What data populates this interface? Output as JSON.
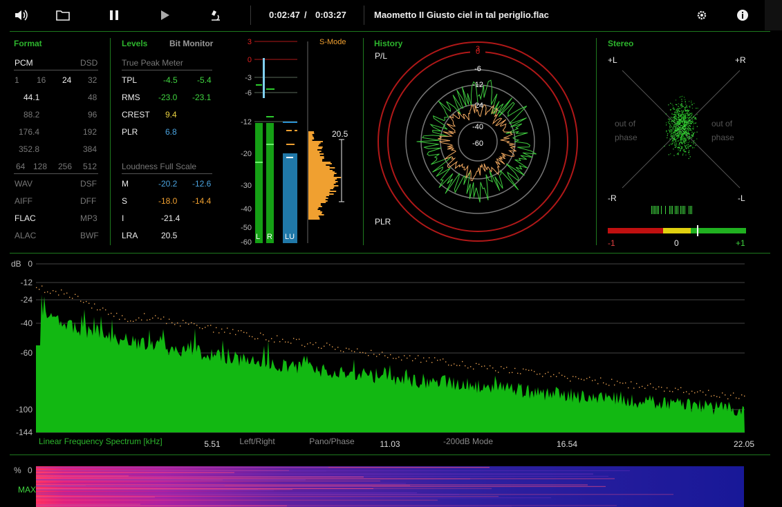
{
  "toolbar": {
    "time_current": "0:02:47",
    "time_separator": "/",
    "time_total": "0:03:27",
    "track_title": "Maometto II Giusto ciel in tal periglio.flac"
  },
  "format": {
    "title": "Format",
    "pcm": "PCM",
    "dsd": "DSD",
    "bits": [
      "1",
      "16",
      "24",
      "32"
    ],
    "rates": [
      [
        "44.1",
        "48"
      ],
      [
        "88.2",
        "96"
      ],
      [
        "176.4",
        "192"
      ],
      [
        "352.8",
        "384"
      ]
    ],
    "dsd_rates": [
      "64",
      "128",
      "256",
      "512"
    ],
    "containers": [
      [
        "WAV",
        "DSF"
      ],
      [
        "AIFF",
        "DFF"
      ],
      [
        "FLAC",
        "MP3"
      ],
      [
        "ALAC",
        "BWF"
      ]
    ]
  },
  "levels": {
    "title": "Levels",
    "bitmonitor": "Bit Monitor",
    "true_peak_label": "True Peak Meter",
    "tpl": {
      "label": "TPL",
      "l": "-4.5",
      "r": "-5.4"
    },
    "rms": {
      "label": "RMS",
      "l": "-23.0",
      "r": "-23.1"
    },
    "crest": {
      "label": "CREST",
      "v": "9.4"
    },
    "plr": {
      "label": "PLR",
      "v": "6.8"
    },
    "loudness_label": "Loudness Full Scale",
    "m": {
      "label": "M",
      "a": "-20.2",
      "b": "-12.6"
    },
    "s": {
      "label": "S",
      "a": "-18.0",
      "b": "-14.4"
    },
    "i": {
      "label": "I",
      "v": "-21.4"
    },
    "lra": {
      "label": "LRA",
      "v": "20.5"
    }
  },
  "meters": {
    "scale": [
      "3",
      "0",
      "-3",
      "-6",
      "-12",
      "-20",
      "-30",
      "-40",
      "-50",
      "-60"
    ],
    "smode": "S-Mode",
    "lra_value": "20.5",
    "l": "L",
    "r": "R",
    "lu": "LU"
  },
  "history": {
    "title": "History",
    "pl": "P/L",
    "plr": "PLR",
    "rings": [
      "3",
      "0",
      "-6",
      "-12",
      "-24",
      "-40",
      "-60"
    ]
  },
  "stereo": {
    "title": "Stereo",
    "plus_l": "+L",
    "plus_r": "+R",
    "minus_r": "-R",
    "minus_l": "-L",
    "out_left": "out of phase",
    "out_right": "out of phase",
    "corr_min": "-1",
    "corr_mid": "0",
    "corr_max": "+1",
    "correlation": 0.3
  },
  "spectrum": {
    "db_label": "dB",
    "y_ticks": [
      "0",
      "-12",
      "-24",
      "-40",
      "-60",
      "-100",
      "-144"
    ],
    "title": "Linear Frequency Spectrum [kHz]",
    "x_ticks": [
      "5.51",
      "11.03",
      "16.54",
      "22.05"
    ],
    "mode_lr": "Left/Right",
    "mode_pano": "Pano/Phase",
    "mode_200": "-200dB Mode"
  },
  "spectrogram": {
    "pct": "%",
    "zero": "0",
    "max": "MAX"
  }
}
